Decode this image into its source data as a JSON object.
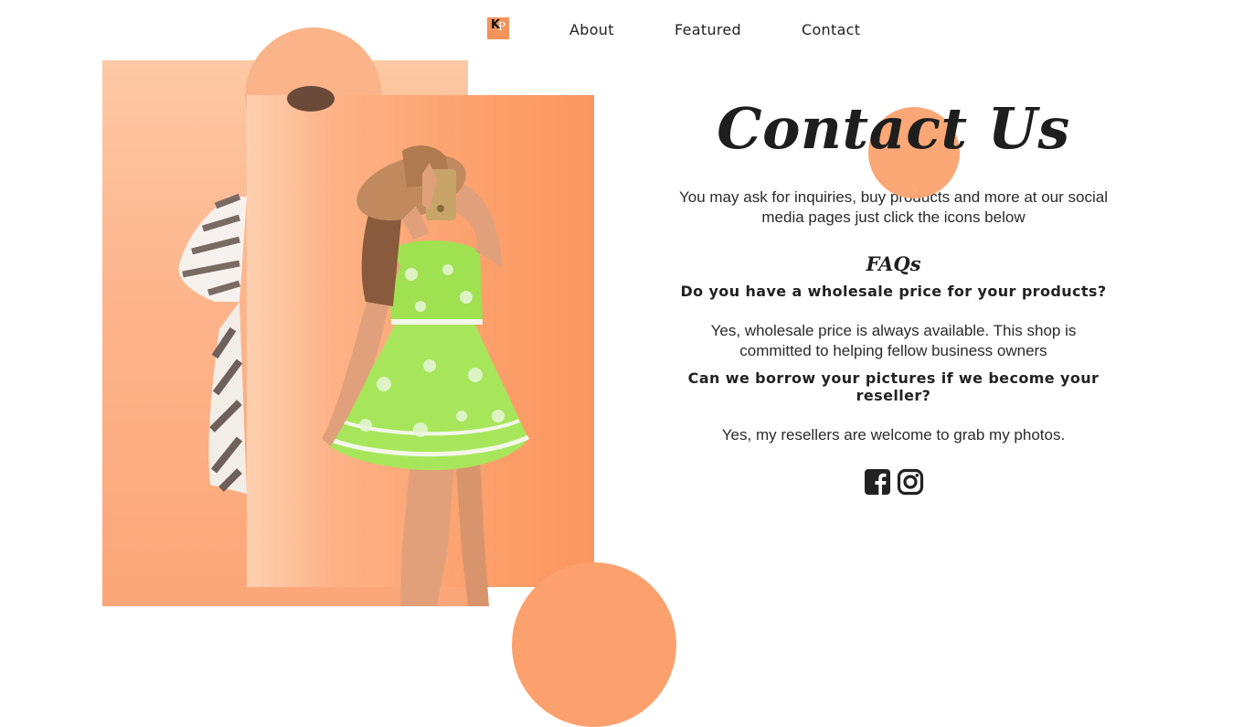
{
  "nav": {
    "logo_alt": "KP logo",
    "logo_mark": "K",
    "logo_letter": "P",
    "links": [
      {
        "label": "About"
      },
      {
        "label": "Featured"
      },
      {
        "label": "Contact"
      }
    ]
  },
  "contact": {
    "title": "Contact Us",
    "intro": "You may ask for inquiries, buy products and more at our social media pages just click the icons below",
    "faqs_heading": "FAQs",
    "faqs": [
      {
        "question": "Do you have a wholesale price for your products?",
        "answer": "Yes, wholesale price is always available. This shop is committed to helping fellow business owners"
      },
      {
        "question": "Can we borrow your pictures if we become your reseller?",
        "answer": "Yes, my resellers are welcome to grab my photos."
      }
    ],
    "social_icons": [
      "facebook-icon",
      "instagram-icon"
    ]
  },
  "colors": {
    "accent": "#fba36f",
    "accent_light": "#fdc8a4",
    "text": "#222222"
  }
}
